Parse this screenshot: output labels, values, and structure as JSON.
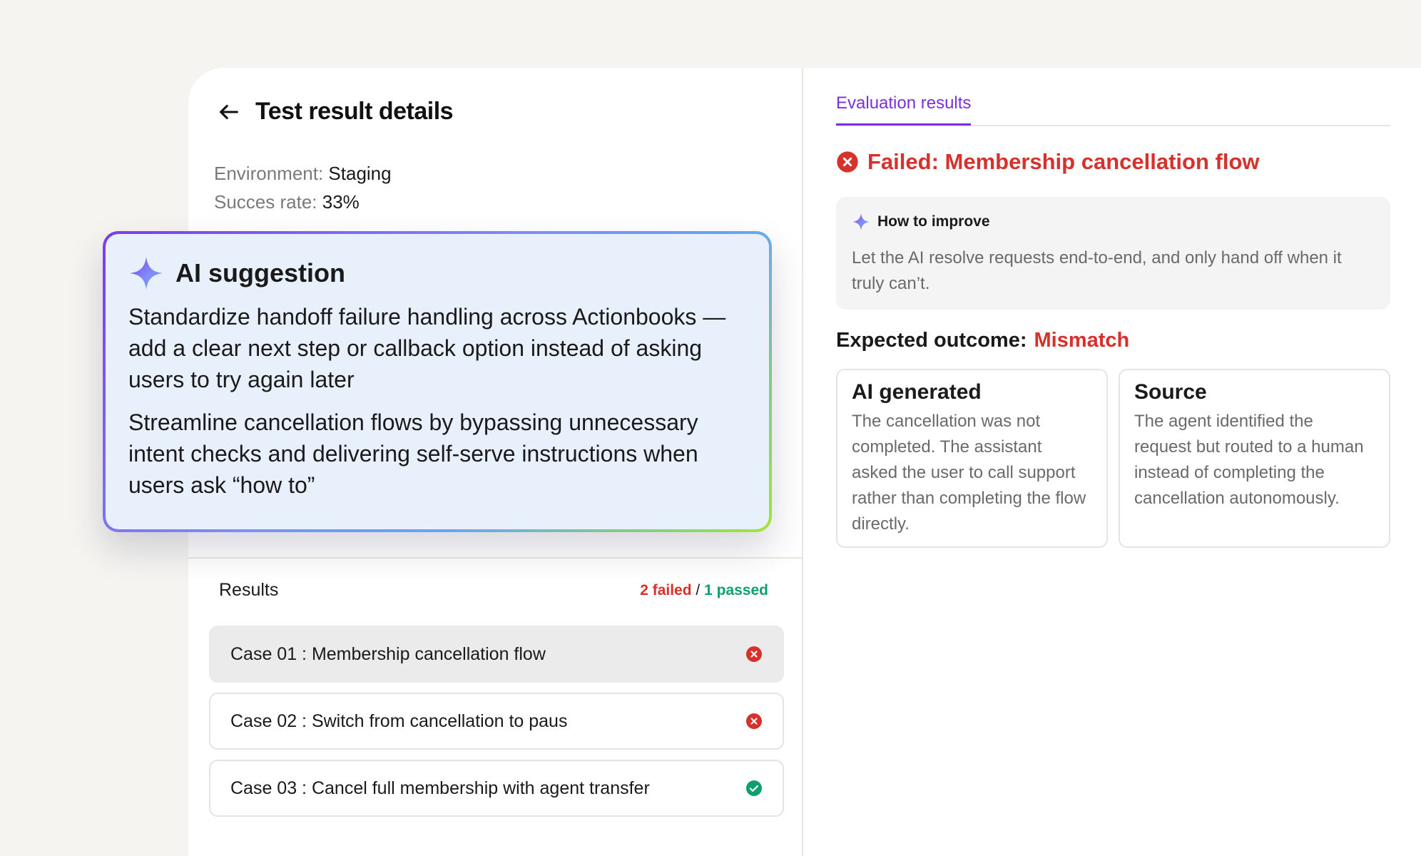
{
  "header": {
    "title": "Test result details",
    "environment_label": "Environment:",
    "environment_value": "Staging",
    "success_label": "Succes rate:",
    "success_value": "33%"
  },
  "ai_suggestion": {
    "title": "AI suggestion",
    "paragraphs": [
      "Standardize handoff failure handling across Actionbooks — add a clear next step or callback option instead of asking users to try again later",
      "Streamline cancellation flows by bypassing unnecessary intent checks and delivering self-serve instructions when users ask “how to”"
    ]
  },
  "results": {
    "title": "Results",
    "failed_label": "2 failed",
    "separator": "/",
    "passed_label": "1 passed",
    "cases": [
      {
        "label": "Case 01 : Membership cancellation flow",
        "status": "failed",
        "selected": true
      },
      {
        "label": "Case 02 : Switch from cancellation to paus",
        "status": "failed",
        "selected": false
      },
      {
        "label": "Case 03 : Cancel full membership with agent transfer",
        "status": "passed",
        "selected": false
      }
    ]
  },
  "evaluation": {
    "tab_label": "Evaluation results",
    "fail_title": "Failed: Membership cancellation flow",
    "improve_title": "How to improve",
    "improve_text": "Let the AI resolve requests end-to-end, and only hand off when it truly can’t.",
    "expected_label": "Expected outcome:",
    "expected_value": "Mismatch",
    "ai_generated_title": "AI generated",
    "ai_generated_text": "The cancellation was not completed. The assistant asked the user to call support rather than completing the flow directly.",
    "source_title": "Source",
    "source_text": "The agent identified the request but routed to a human instead of completing the cancellation autonomously."
  },
  "colors": {
    "accent": "#7b2fe0",
    "failed": "#d7312c",
    "passed": "#0f9f6e",
    "background": "#f5f4f0"
  },
  "icons": [
    "back-arrow-icon",
    "sparkle-icon",
    "error-x-icon",
    "check-icon"
  ]
}
